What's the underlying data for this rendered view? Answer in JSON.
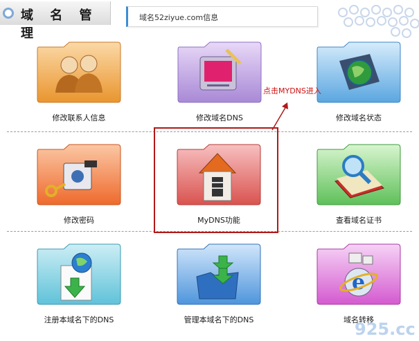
{
  "header": {
    "title": "域 名 管 理",
    "domain_info": "域名52ziyue.com信息"
  },
  "annotation": "点击MYDNS进入",
  "tiles": [
    {
      "label": "修改联系人信息",
      "icon": "contacts-icon",
      "color": "orange"
    },
    {
      "label": "修改域名DNS",
      "icon": "computer-icon",
      "color": "purple"
    },
    {
      "label": "修改域名状态",
      "icon": "globe-icon",
      "color": "blue"
    },
    {
      "label": "修改密码",
      "icon": "key-lock-icon",
      "color": "orange-red"
    },
    {
      "label": "MyDNS功能",
      "icon": "house-icon",
      "color": "red"
    },
    {
      "label": "查看域名证书",
      "icon": "magnifier-book-icon",
      "color": "green"
    },
    {
      "label": "注册本域名下的DNS",
      "icon": "register-dns-icon",
      "color": "cyan"
    },
    {
      "label": "管理本域名下的DNS",
      "icon": "manage-dns-icon",
      "color": "blue"
    },
    {
      "label": "域名转移",
      "icon": "ie-transfer-icon",
      "color": "magenta"
    }
  ],
  "watermark": "925.cc"
}
